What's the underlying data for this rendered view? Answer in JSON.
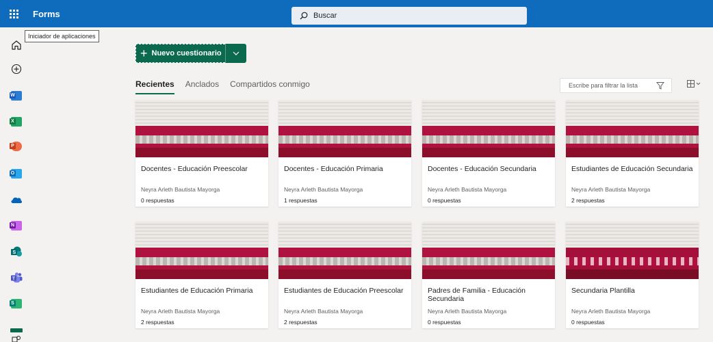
{
  "header": {
    "app_name": "Forms",
    "search_placeholder": "Buscar"
  },
  "tooltip": "Iniciador de aplicaciones",
  "rail": [
    {
      "name": "home-icon",
      "color": "#201f1e"
    },
    {
      "name": "create-icon",
      "color": "#201f1e"
    },
    {
      "name": "word-icon",
      "color": "#185abd",
      "letter": "W"
    },
    {
      "name": "excel-icon",
      "color": "#107c41",
      "letter": "X"
    },
    {
      "name": "powerpoint-icon",
      "color": "#c43e1c",
      "letter": "P"
    },
    {
      "name": "outlook-icon",
      "color": "#0f6cbd",
      "letter": "O"
    },
    {
      "name": "onedrive-icon",
      "color": "#0364b8"
    },
    {
      "name": "onenote-icon",
      "color": "#7719aa",
      "letter": "N"
    },
    {
      "name": "sharepoint-icon",
      "color": "#038387",
      "letter": "S"
    },
    {
      "name": "teams-icon",
      "color": "#4b53bc"
    },
    {
      "name": "sway-icon",
      "color": "#008272",
      "letter": "S"
    }
  ],
  "new_button": {
    "label": "Nuevo cuestionario"
  },
  "tabs": [
    "Recientes",
    "Anclados",
    "Compartidos conmigo"
  ],
  "filter_placeholder": "Escribe para filtrar la lista",
  "colors": {
    "accent": "#0b6a4e",
    "topbar": "#0f6cbd",
    "thumb_red": "#b0123f"
  },
  "forms": [
    {
      "title": "Docentes - Educación Preescolar",
      "owner": "Neyra Arleth Bautista Mayorga",
      "responses": "0 respuestas"
    },
    {
      "title": "Docentes - Educación Primaria",
      "owner": "Neyra Arleth Bautista Mayorga",
      "responses": "1 respuestas"
    },
    {
      "title": "Docentes - Educación Secundaria",
      "owner": "Neyra Arleth Bautista Mayorga",
      "responses": "0 respuestas"
    },
    {
      "title": "Estudiantes de Educación Secundaria",
      "owner": "Neyra Arleth Bautista Mayorga",
      "responses": "2 respuestas"
    },
    {
      "title": "Estudiantes de Educación Primaria",
      "owner": "Neyra Arleth Bautista Mayorga",
      "responses": "2 respuestas"
    },
    {
      "title": "Estudiantes de Educación Preescolar",
      "owner": "Neyra Arleth Bautista Mayorga",
      "responses": "2 respuestas"
    },
    {
      "title": "Padres de Familia - Educación Secundaria",
      "owner": "Neyra Arleth Bautista Mayorga",
      "responses": "0 respuestas"
    },
    {
      "title": "Secundaria Plantilla",
      "owner": "Neyra Arleth Bautista Mayorga",
      "responses": "0 respuestas"
    }
  ]
}
